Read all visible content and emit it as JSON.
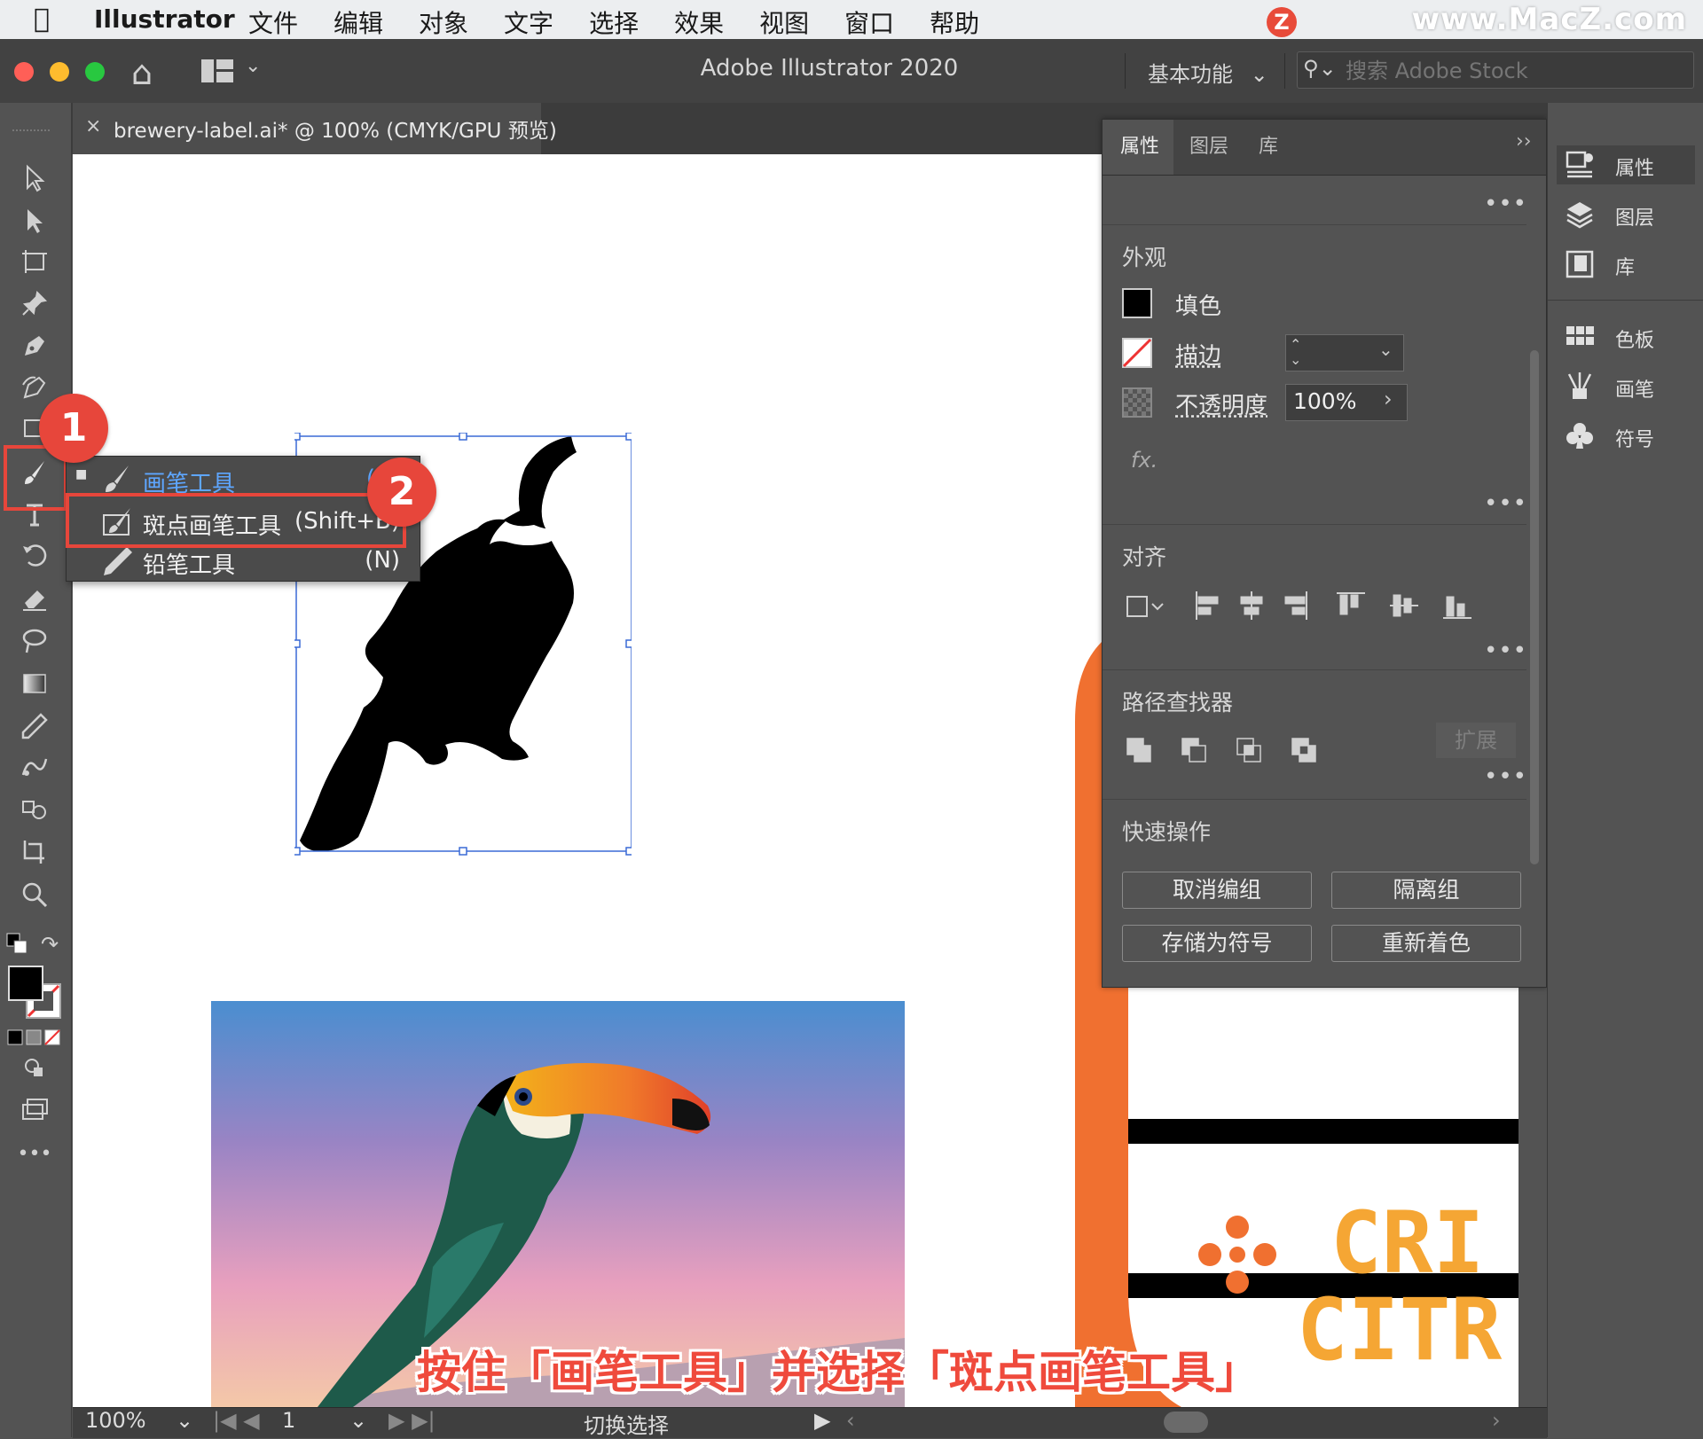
{
  "menubar": {
    "app_name": "Illustrator",
    "items": [
      "文件",
      "编辑",
      "对象",
      "文字",
      "选择",
      "效果",
      "视图",
      "窗口",
      "帮助"
    ],
    "watermark": "www.MacZ.com",
    "watermark_badge": "Z"
  },
  "titlebar": {
    "title": "Adobe Illustrator 2020",
    "workspace": "基本功能",
    "search_placeholder": "搜索 Adobe Stock"
  },
  "document_tab": {
    "close": "×",
    "name": "brewery-label.ai* @ 100% (CMYK/GPU 预览)"
  },
  "toolbar": {
    "collapse": "››",
    "more": "•••"
  },
  "flyout": {
    "items": [
      {
        "label": "画笔工具",
        "shortcut": "(B)",
        "selected": true
      },
      {
        "label": "斑点画笔工具",
        "shortcut": "(Shift+B)",
        "selected": false
      },
      {
        "label": "铅笔工具",
        "shortcut": "(N)",
        "selected": false
      }
    ]
  },
  "badges": {
    "one": "1",
    "two": "2"
  },
  "panel": {
    "tabs": [
      "属性",
      "图层",
      "库"
    ],
    "expand": "››",
    "appearance": {
      "title": "外观",
      "fill_label": "填色",
      "stroke_label": "描边",
      "opacity_label": "不透明度",
      "opacity_value": "100%",
      "fx": "fx."
    },
    "align": {
      "title": "对齐"
    },
    "pathfinder": {
      "title": "路径查找器",
      "expand_button": "扩展"
    },
    "quick_actions": {
      "title": "快速操作",
      "buttons": [
        "取消编组",
        "隔离组",
        "存储为符号",
        "重新着色"
      ]
    },
    "more": "•••"
  },
  "dock": {
    "collapse": "‹‹",
    "items": [
      "属性",
      "图层",
      "库",
      "色板",
      "画笔",
      "符号"
    ]
  },
  "statusbar": {
    "zoom": "100%",
    "artboard": "1",
    "tool_status": "切换选择"
  },
  "artwork": {
    "label_text_line1": "CRI",
    "label_text_line2": "CITR"
  },
  "caption": "按住「画笔工具」并选择「斑点画笔工具」",
  "colors": {
    "accent_red": "#e7463b",
    "orange": "#f07030",
    "label_yellow": "#f5a634",
    "selection_blue": "#3a6ad6"
  }
}
